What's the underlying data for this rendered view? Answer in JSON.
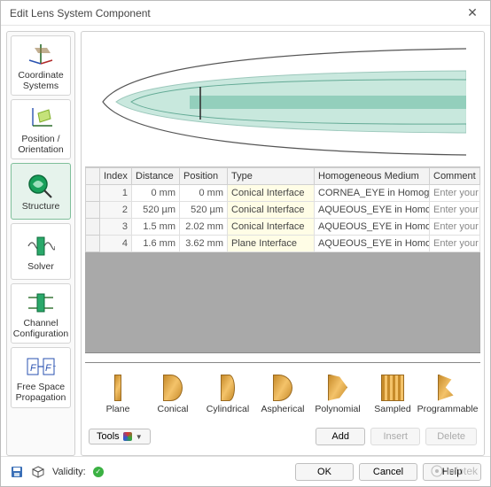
{
  "window": {
    "title": "Edit Lens System Component"
  },
  "sidebar": {
    "items": [
      {
        "label": "Coordinate Systems",
        "key": "coord"
      },
      {
        "label": "Position / Orientation",
        "key": "pos"
      },
      {
        "label": "Structure",
        "key": "structure",
        "active": true
      },
      {
        "label": "Solver",
        "key": "solver"
      },
      {
        "label": "Channel Configuration",
        "key": "channel"
      },
      {
        "label": "Free Space Propagation",
        "key": "freespace"
      }
    ]
  },
  "table": {
    "columns": [
      "",
      "Index",
      "Distance",
      "Position",
      "Type",
      "Homogeneous Medium",
      "Comment"
    ],
    "rows": [
      {
        "index": "1",
        "distance": "0 mm",
        "position": "0 mm",
        "type": "Conical Interface",
        "medium": "CORNEA_EYE in Homog",
        "comment": "Enter your comm"
      },
      {
        "index": "2",
        "distance": "520 µm",
        "position": "520 µm",
        "type": "Conical Interface",
        "medium": "AQUEOUS_EYE in Homo",
        "comment": "Enter your comm"
      },
      {
        "index": "3",
        "distance": "1.5 mm",
        "position": "2.02 mm",
        "type": "Conical Interface",
        "medium": "AQUEOUS_EYE in Homo",
        "comment": "Enter your comm"
      },
      {
        "index": "4",
        "distance": "1.6 mm",
        "position": "3.62 mm",
        "type": "Plane Interface",
        "medium": "AQUEOUS_EYE in Homo",
        "comment": "Enter your comm"
      }
    ]
  },
  "palette": {
    "items": [
      {
        "label": "Plane",
        "shape": "plane"
      },
      {
        "label": "Conical",
        "shape": "conical"
      },
      {
        "label": "Cylindrical",
        "shape": "cylindrical"
      },
      {
        "label": "Aspherical",
        "shape": "aspherical"
      },
      {
        "label": "Polynomial",
        "shape": "polynomial"
      },
      {
        "label": "Sampled",
        "shape": "sampled"
      },
      {
        "label": "Programmable",
        "shape": "programmable"
      }
    ]
  },
  "toolbar": {
    "tools_label": "Tools",
    "add_label": "Add",
    "insert_label": "Insert",
    "delete_label": "Delete"
  },
  "footer": {
    "validity_label": "Validity:",
    "ok_label": "OK",
    "cancel_label": "Cancel",
    "help_label": "Help"
  },
  "watermark": "infotek"
}
